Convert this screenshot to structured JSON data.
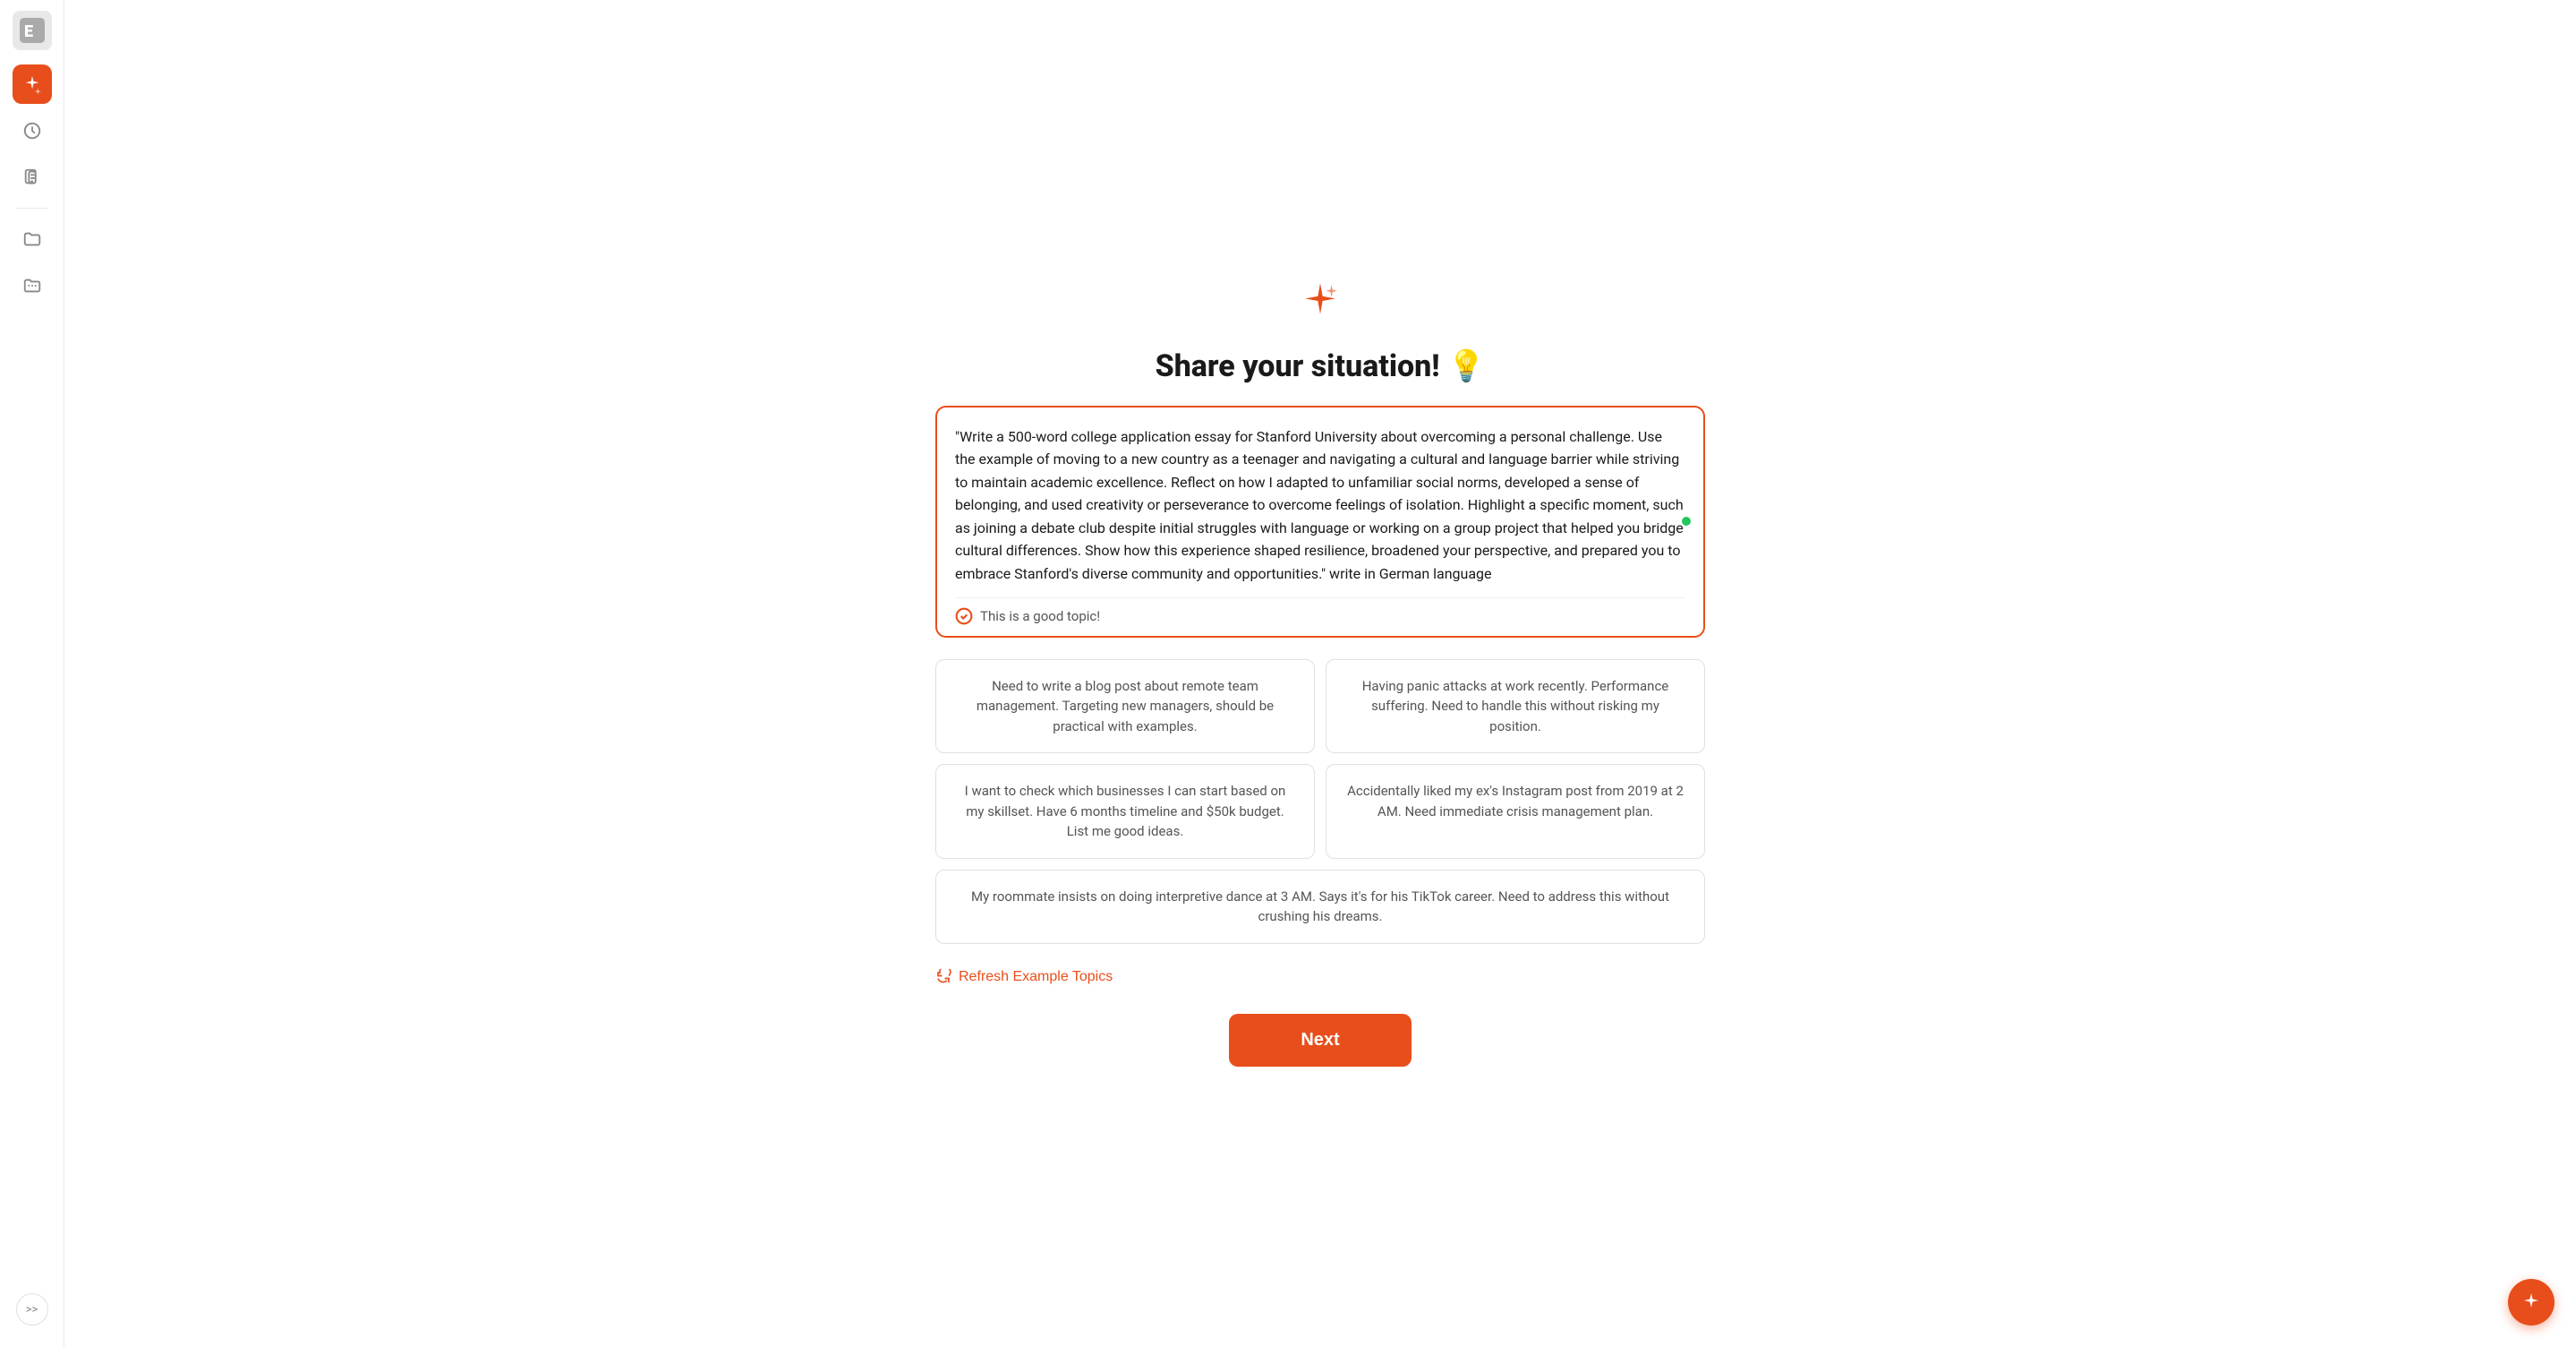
{
  "sidebar": {
    "logo_label": "E",
    "items": [
      {
        "name": "ai-assistant",
        "label": "AI Assistant",
        "active": true
      },
      {
        "name": "history",
        "label": "History",
        "active": false
      },
      {
        "name": "documents",
        "label": "Documents",
        "active": false
      },
      {
        "name": "folder",
        "label": "Folder",
        "active": false
      },
      {
        "name": "folder2",
        "label": "Folder 2",
        "active": false
      }
    ],
    "collapse_label": ">>"
  },
  "page": {
    "spark_icon": "✦",
    "title": "Share your situation!",
    "title_emoji": "💡",
    "textarea_value": "\"Write a 500-word college application essay for Stanford University about overcoming a personal challenge. Use the example of moving to a new country as a teenager and navigating a cultural and language barrier while striving to maintain academic excellence. Reflect on how I adapted to unfamiliar social norms, developed a sense of belonging, and used creativity or perseverance to overcome feelings of isolation. Highlight a specific moment, such as joining a debate club despite initial struggles with language or working on a group project that helped you bridge cultural differences. Show how this experience shaped resilience, broadened your perspective, and prepared you to embrace Stanford's diverse community and opportunities.\" write in German language",
    "good_topic_label": "This is a good topic!",
    "examples": [
      {
        "id": "ex1",
        "text": "Need to write a blog post about remote team management. Targeting new managers, should be practical with examples.",
        "wide": false
      },
      {
        "id": "ex2",
        "text": "Having panic attacks at work recently. Performance suffering. Need to handle this without risking my position.",
        "wide": false
      },
      {
        "id": "ex3",
        "text": "I want to check which businesses I can start based on my skillset. Have 6 months timeline and $50k budget. List me good ideas.",
        "wide": false
      },
      {
        "id": "ex4",
        "text": "Accidentally liked my ex's Instagram post from 2019 at 2 AM. Need immediate crisis management plan.",
        "wide": false
      },
      {
        "id": "ex5",
        "text": "My roommate insists on doing interpretive dance at 3 AM. Says it's for his TikTok career. Need to address this without crushing his dreams.",
        "wide": true
      }
    ],
    "refresh_label": "Refresh Example Topics",
    "next_label": "Next"
  }
}
